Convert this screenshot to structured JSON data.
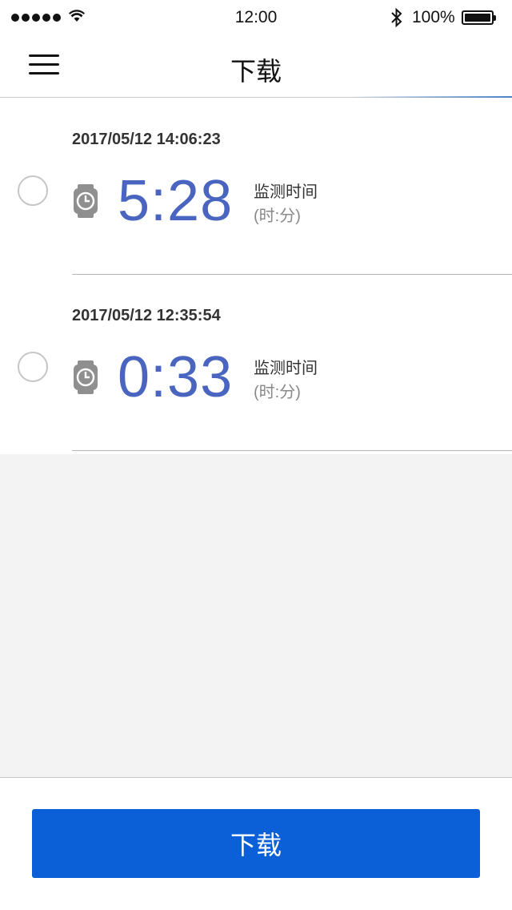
{
  "status_bar": {
    "time": "12:00",
    "battery_percent": "100%",
    "icons": [
      "signal-dots-icon",
      "wifi-icon",
      "bluetooth-icon",
      "battery-icon"
    ]
  },
  "navbar": {
    "title": "下载",
    "menu_icon": "hamburger-menu-icon"
  },
  "records": [
    {
      "datetime": "2017/05/12 14:06:23",
      "duration": "5:28",
      "label": "监测时间",
      "unit": "(时:分)",
      "selected": false,
      "icon": "watch-icon"
    },
    {
      "datetime": "2017/05/12 12:35:54",
      "duration": "0:33",
      "label": "监测时间",
      "unit": "(时:分)",
      "selected": false,
      "icon": "watch-icon"
    }
  ],
  "footer": {
    "download_label": "下载"
  },
  "colors": {
    "accent": "#0b5fd7",
    "duration_text": "#4a65c0",
    "background_empty": "#f3f3f3"
  }
}
